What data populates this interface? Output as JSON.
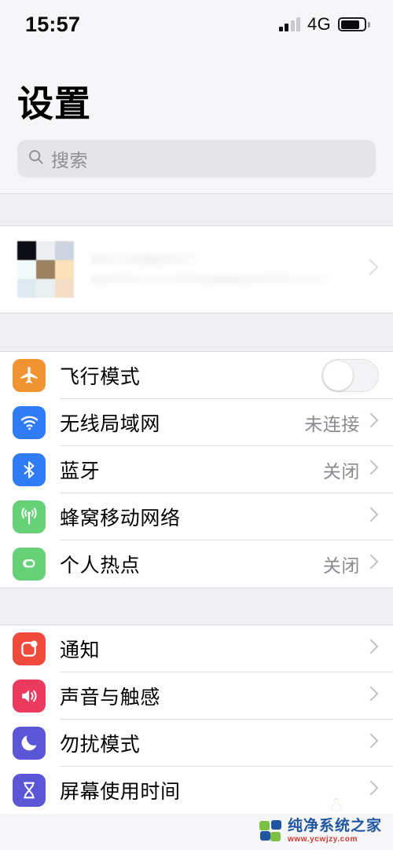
{
  "status_bar": {
    "time": "15:57",
    "network": "4G",
    "signal_icon": "signal-bars-icon",
    "signal_bars_active": 2,
    "signal_bars_total": 4,
    "battery_icon": "battery-icon",
    "battery_level_percent": 72
  },
  "header": {
    "title": "设置"
  },
  "search": {
    "placeholder": "搜索",
    "value": "",
    "icon": "search-icon"
  },
  "apple_id": {
    "name": "",
    "subtitle": "",
    "redacted": true,
    "avatar_icon": "avatar-mosaic",
    "avatar_colors": [
      "#0c0c14",
      "#edeef2",
      "#ced4e0",
      "#f2fafc",
      "#9b8362",
      "#fbe2bb",
      "#dfeaf0",
      "#eaf0f2",
      "#f3ddc4"
    ],
    "chevron": "chevron-right-icon"
  },
  "groups": [
    {
      "name": "connectivity",
      "rows": [
        {
          "label": "飞行模式",
          "icon": "airplane-icon",
          "icon_color": "#f09433",
          "control": "toggle",
          "toggle_on": false,
          "value": ""
        },
        {
          "label": "无线局域网",
          "icon": "wifi-icon",
          "icon_color": "#2f7cf6",
          "control": "chevron",
          "value": "未连接"
        },
        {
          "label": "蓝牙",
          "icon": "bluetooth-icon",
          "icon_color": "#2f7cf6",
          "control": "chevron",
          "value": "关闭"
        },
        {
          "label": "蜂窝移动网络",
          "icon": "cellular-icon",
          "icon_color": "#67d177",
          "control": "chevron",
          "value": ""
        },
        {
          "label": "个人热点",
          "icon": "personal-hotspot-icon",
          "icon_color": "#67d177",
          "control": "chevron",
          "value": "关闭"
        }
      ]
    },
    {
      "name": "alerts",
      "rows": [
        {
          "label": "通知",
          "icon": "notifications-icon",
          "icon_color": "#ef4a3c",
          "control": "chevron",
          "value": ""
        },
        {
          "label": "声音与触感",
          "icon": "sounds-haptics-icon",
          "icon_color": "#ea3a5e",
          "control": "chevron",
          "value": ""
        },
        {
          "label": "勿扰模式",
          "icon": "do-not-disturb-icon",
          "icon_color": "#5a56d6",
          "control": "chevron",
          "value": ""
        },
        {
          "label": "屏幕使用时间",
          "icon": "screen-time-icon",
          "icon_color": "#5a56d6",
          "control": "chevron",
          "value": ""
        }
      ]
    }
  ],
  "watermark": {
    "site_name": "纯净系统之家",
    "url": "www.ycwjzy.com",
    "logo_icon": "four-squares-logo"
  }
}
